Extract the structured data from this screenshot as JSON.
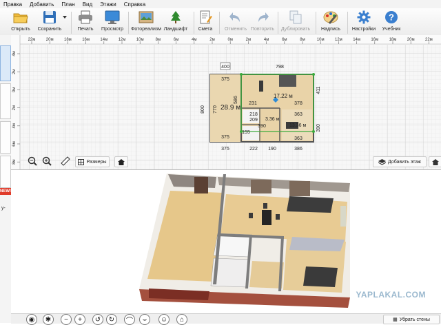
{
  "menu": [
    "Правка",
    "Добавить",
    "План",
    "Вид",
    "Этажи",
    "Справка"
  ],
  "toolbar": {
    "open": "Открыть",
    "save": "Сохранить",
    "print": "Печать",
    "preview": "Просмотр",
    "photoreal": "Фотореализм",
    "landscape": "Ландшафт",
    "estimate": "Смета",
    "undo": "Отменить",
    "redo": "Повторить",
    "duplicate": "Дублировать",
    "label": "Надпись",
    "settings": "Настройки",
    "tutorial": "Учебник"
  },
  "ruler": {
    "top": [
      "22м",
      "20м",
      "18м",
      "16м",
      "14м",
      "12м",
      "10м",
      "8м",
      "6м",
      "4м",
      "2м",
      "0м",
      "2м",
      "4м",
      "6м",
      "8м",
      "10м",
      "12м",
      "14м",
      "16м",
      "18м",
      "20м",
      "22м"
    ],
    "left": [
      "4м",
      "2м",
      "0м",
      "2м",
      "4м",
      "6м",
      "8м"
    ]
  },
  "plan": {
    "dimensions": [
      "798",
      "400",
      "375",
      "375",
      "800",
      "770",
      "586",
      "231",
      "411",
      "378",
      "363",
      "363",
      "390",
      "390",
      "222",
      "190",
      "386",
      "218",
      "209",
      "155"
    ],
    "room_areas": [
      "28.9 м",
      "17.22 м",
      "3.36 м",
      "13.36 м"
    ]
  },
  "buttons": {
    "sizes": "Размеры",
    "add_floor": "Добавить этаж",
    "remove_walls": "Убрать стены"
  },
  "left_panel": {
    "new_badge": "NEW!",
    "partial_label": "у-"
  },
  "watermark": "YAPLAKAL.COM",
  "colors": {
    "accent": "#2e8bd6",
    "selection": "#3caa3c",
    "floor": "#e9c98f",
    "wall": "#5a5a5a"
  }
}
